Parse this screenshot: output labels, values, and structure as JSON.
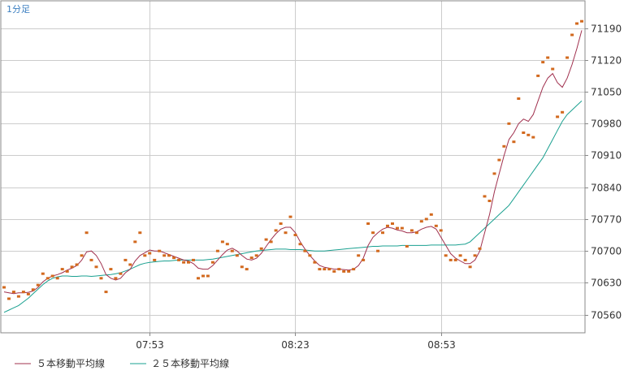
{
  "chart_data": {
    "type": "line",
    "timeframe_label": "1分足",
    "ylim": [
      70520,
      71250
    ],
    "y_ticks": [
      70560,
      70630,
      70700,
      70770,
      70840,
      70910,
      70980,
      71050,
      71120,
      71190
    ],
    "y_tick_labels": [
      "70560",
      "70630",
      "70700",
      "70770",
      "70840",
      "70910",
      "70980",
      "71050",
      "71120",
      "71190"
    ],
    "x_ticks": [
      {
        "index": 30,
        "label": "07:53"
      },
      {
        "index": 60,
        "label": "08:23"
      },
      {
        "index": 90,
        "label": "08:53"
      }
    ],
    "grid": true,
    "point_count": 120,
    "series": [
      {
        "name": "",
        "kind": "points",
        "color": "#d2691e",
        "values": [
          70620,
          70595,
          70610,
          70600,
          70610,
          70605,
          70615,
          70625,
          70650,
          70640,
          70645,
          70640,
          70660,
          70655,
          70665,
          70670,
          70690,
          70740,
          70680,
          70665,
          70640,
          70610,
          70660,
          70640,
          70650,
          70680,
          70670,
          70720,
          70740,
          70690,
          70695,
          70680,
          70700,
          70690,
          70690,
          70685,
          70680,
          70675,
          70675,
          70680,
          70640,
          70645,
          70645,
          70675,
          70700,
          70720,
          70715,
          70700,
          70690,
          70665,
          70660,
          70685,
          70690,
          70705,
          70725,
          70720,
          70745,
          70760,
          70740,
          70775,
          70735,
          70715,
          70700,
          70690,
          70675,
          70660,
          70660,
          70660,
          70655,
          70660,
          70655,
          70655,
          70660,
          70690,
          70680,
          70760,
          70740,
          70700,
          70740,
          70755,
          70760,
          70750,
          70750,
          70710,
          70745,
          70740,
          70765,
          70770,
          70780,
          70755,
          70745,
          70690,
          70680,
          70680,
          70690,
          70680,
          70665,
          70690,
          70705,
          70820,
          70810,
          70870,
          70900,
          70930,
          70980,
          70940,
          71035,
          70960,
          70955,
          70950,
          71085,
          71115,
          71125,
          71100,
          70995,
          71005,
          71125,
          71175,
          71200,
          71205
        ]
      },
      {
        "name": "5本移動平均線",
        "kind": "line",
        "color": "#a0304e",
        "values": [
          70610,
          70608,
          70606,
          70608,
          70608,
          70609,
          70612,
          70620,
          70632,
          70640,
          70645,
          70648,
          70652,
          70658,
          70662,
          70668,
          70680,
          70698,
          70700,
          70690,
          70672,
          70648,
          70640,
          70636,
          70640,
          70652,
          70660,
          70678,
          70690,
          70696,
          70702,
          70700,
          70700,
          70696,
          70692,
          70688,
          70684,
          70680,
          70678,
          70672,
          70662,
          70660,
          70660,
          70668,
          70680,
          70692,
          70702,
          70706,
          70700,
          70690,
          70682,
          70680,
          70684,
          70695,
          70710,
          70725,
          70738,
          70748,
          70752,
          70752,
          70740,
          70720,
          70704,
          70690,
          70678,
          70668,
          70664,
          70662,
          70660,
          70660,
          70659,
          70658,
          70660,
          70668,
          70684,
          70712,
          70730,
          70740,
          70748,
          70752,
          70750,
          70746,
          70744,
          70740,
          70740,
          70742,
          70748,
          70752,
          70754,
          70748,
          70730,
          70712,
          70694,
          70684,
          70678,
          70672,
          70672,
          70680,
          70700,
          70740,
          70780,
          70830,
          70870,
          70910,
          70945,
          70960,
          70980,
          70990,
          70985,
          71000,
          71030,
          71060,
          71080,
          71090,
          71070,
          71060,
          71080,
          71110,
          71145,
          71185
        ]
      },
      {
        "name": "２５本移動平均線",
        "kind": "line",
        "color": "#1aa090",
        "values": [
          70565,
          70570,
          70575,
          70580,
          70588,
          70596,
          70606,
          70616,
          70626,
          70634,
          70640,
          70643,
          70645,
          70645,
          70644,
          70644,
          70645,
          70645,
          70644,
          70645,
          70646,
          70647,
          70648,
          70650,
          70652,
          70656,
          70660,
          70665,
          70670,
          70673,
          70675,
          70676,
          70677,
          70678,
          70678,
          70679,
          70680,
          70680,
          70680,
          70680,
          70680,
          70680,
          70681,
          70682,
          70684,
          70686,
          70688,
          70690,
          70692,
          70694,
          70696,
          70698,
          70700,
          70701,
          70702,
          70703,
          70704,
          70704,
          70704,
          70703,
          70703,
          70703,
          70702,
          70701,
          70700,
          70700,
          70700,
          70701,
          70702,
          70703,
          70704,
          70705,
          70706,
          70707,
          70708,
          70709,
          70710,
          70710,
          70711,
          70711,
          70711,
          70711,
          70712,
          70712,
          70712,
          70712,
          70712,
          70712,
          70713,
          70713,
          70713,
          70713,
          70713,
          70713,
          70714,
          70715,
          70720,
          70730,
          70740,
          70750,
          70760,
          70770,
          70780,
          70790,
          70800,
          70815,
          70830,
          70845,
          70860,
          70875,
          70890,
          70905,
          70925,
          70945,
          70965,
          70985,
          71000,
          71010,
          71020,
          71030
        ]
      }
    ]
  },
  "legend": {
    "item1": "５本移動平均線",
    "item2": "２５本移動平均線"
  },
  "colors": {
    "grid": "#cccccc",
    "frame": "#888888",
    "ma5": "#a0304e",
    "ma25": "#1aa090",
    "price": "#d2691e",
    "timeframe": "#3a7ec0"
  }
}
